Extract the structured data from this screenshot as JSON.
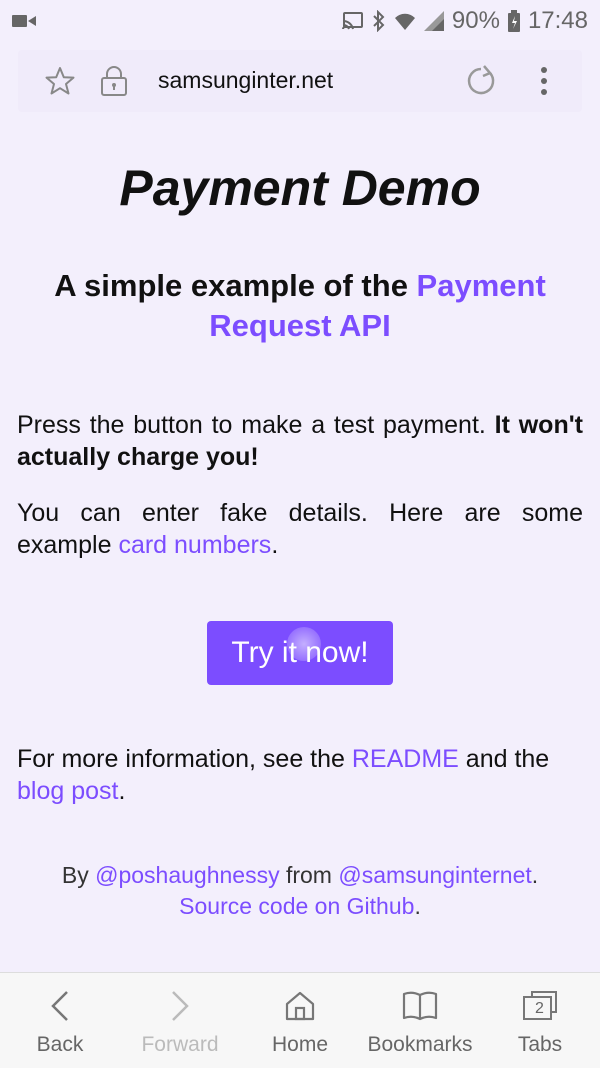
{
  "status_bar": {
    "battery": "90%",
    "time": "17:48",
    "icons": [
      "video-camera-icon",
      "cast-icon",
      "bluetooth-icon",
      "wifi-icon",
      "signal-icon",
      "battery-icon"
    ]
  },
  "browser": {
    "url": "samsunginter.net",
    "icons": [
      "star-icon",
      "lock-icon",
      "reload-icon",
      "more-vertical-icon"
    ]
  },
  "page": {
    "title": "Payment Demo",
    "subtitle_prefix": "A simple example of the ",
    "subtitle_link": "Payment Request API",
    "p1_text": "Press the button to make a test payment. ",
    "p1_bold": "It won't actually charge you!",
    "p2_text": "You can enter fake details. Here are some example ",
    "p2_link": "card numbers",
    "p2_suffix": ".",
    "button_label": "Try it now!",
    "p3_text": "For more information, see the ",
    "p3_link1": "README",
    "p3_mid": " and the ",
    "p3_link2": "blog post",
    "p3_suffix": ".",
    "footer_by": "By ",
    "footer_author": "@poshaughnessy",
    "footer_from": " from ",
    "footer_org": "@samsunginternet",
    "footer_dot": ".",
    "footer_source": "Source code on Github",
    "footer_end": "."
  },
  "bottom_nav": [
    {
      "label": "Back",
      "icon": "chevron-left-icon"
    },
    {
      "label": "Forward",
      "icon": "chevron-right-icon",
      "disabled": true
    },
    {
      "label": "Home",
      "icon": "home-icon"
    },
    {
      "label": "Bookmarks",
      "icon": "bookmarks-icon"
    },
    {
      "label": "Tabs",
      "icon": "tabs-icon",
      "badge": "2"
    }
  ],
  "colors": {
    "accent": "#7c4dff",
    "background": "#f3effc"
  }
}
